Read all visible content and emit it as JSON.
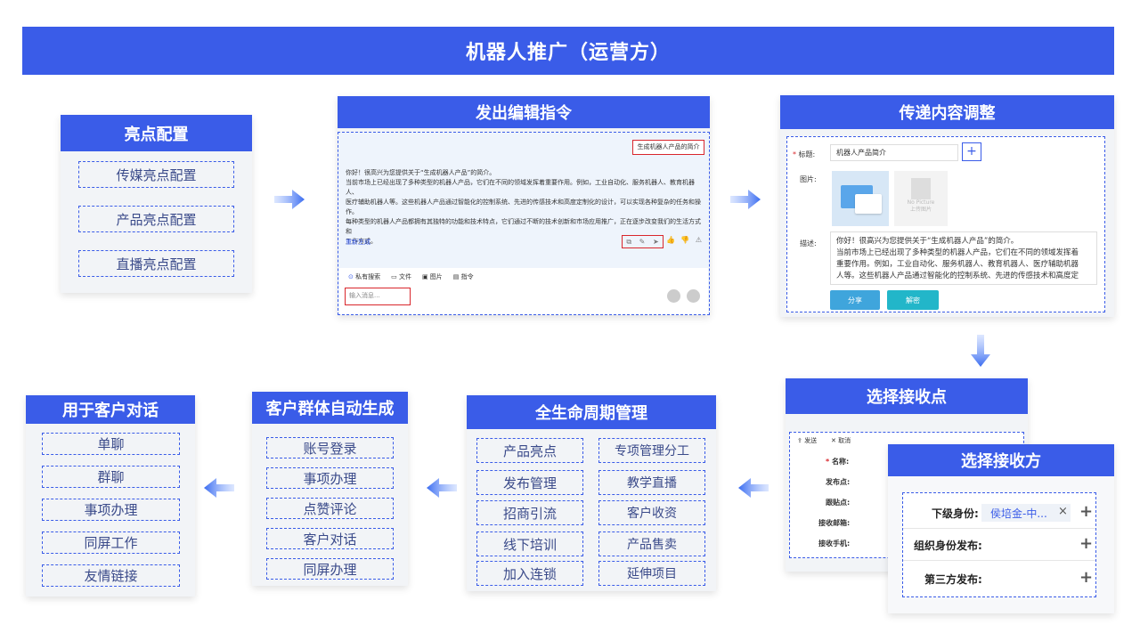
{
  "banner": {
    "title": "机器人推广（运营方）"
  },
  "highlight_config": {
    "title": "亮点配置",
    "items": [
      "传媒亮点配置",
      "产品亮点配置",
      "直播亮点配置"
    ]
  },
  "edit_command": {
    "title": "发出编辑指令",
    "tag": "生成机器人产品的简介",
    "message_lines": [
      "你好！很高兴为您提供关于“生成机器人产品”的简介。",
      "当前市场上已经出现了多种类型的机器人产品，它们在不同的领域发挥着重要作用。例如，工业自动化、服务机器人、教育机器人、",
      "医疗辅助机器人等。这些机器人产品通过智能化的控制系统、先进的传感技术和高度定制化的设计，可以实现各种复杂的任务和操",
      "作。",
      "每种类型的机器人产品都拥有其独特的功能和技术特点，它们通过不断的技术创新和市场应用推广，正在逐步改变我们的生活方式和",
      "工作方式。"
    ],
    "regenerate": "重新生成",
    "toolbar": [
      "私有搜索",
      "文件",
      "图片",
      "指令"
    ],
    "input_placeholder": "输入消息..."
  },
  "content_adjust": {
    "title": "传递内容调整",
    "label_title": "标题:",
    "title_value": "机器人产品简介",
    "label_image": "图片:",
    "no_picture": "No Picture",
    "upload": "上传图片",
    "label_desc": "描述:",
    "desc_lines": [
      "你好！很高兴为您提供关于“生成机器人产品”的简介。",
      "当前市场上已经出现了多种类型的机器人产品，它们在不同的领域发挥着",
      "重要作用。例如，工业自动化、服务机器人、教育机器人、医疗辅助机器",
      "人等。这些机器人产品通过智能化的控制系统、先进的传感技术和高度定"
    ],
    "share_btn": "分享",
    "parse_btn": "解密"
  },
  "select_point": {
    "title": "选择接收点",
    "send": "发送",
    "cancel": "取消",
    "fields": [
      "名称:",
      "发布点:",
      "跟贴点:",
      "接收邮箱:",
      "接收手机:"
    ]
  },
  "select_party": {
    "title": "选择接收方",
    "rows": [
      "下级身份:",
      "组织身份发布:",
      "第三方发布:"
    ],
    "chip": "侯培金-中..."
  },
  "lifecycle": {
    "title": "全生命周期管理",
    "left": [
      "产品亮点",
      "发布管理",
      "招商引流",
      "线下培训",
      "加入连锁"
    ],
    "right": [
      "专项管理分工",
      "教学直播",
      "客户收资",
      "产品售卖",
      "延伸项目"
    ]
  },
  "auto_group": {
    "title": "客户群体自动生成",
    "items": [
      "账号登录",
      "事项办理",
      "点赞评论",
      "客户对话",
      "同屏办理"
    ]
  },
  "customer_dialog": {
    "title": "用于客户对话",
    "items": [
      "单聊",
      "群聊",
      "事项办理",
      "同屏工作",
      "友情链接"
    ]
  },
  "colors": {
    "primary": "#3a5ce8",
    "red": "#d9262c",
    "teal": "#22b6c9"
  }
}
